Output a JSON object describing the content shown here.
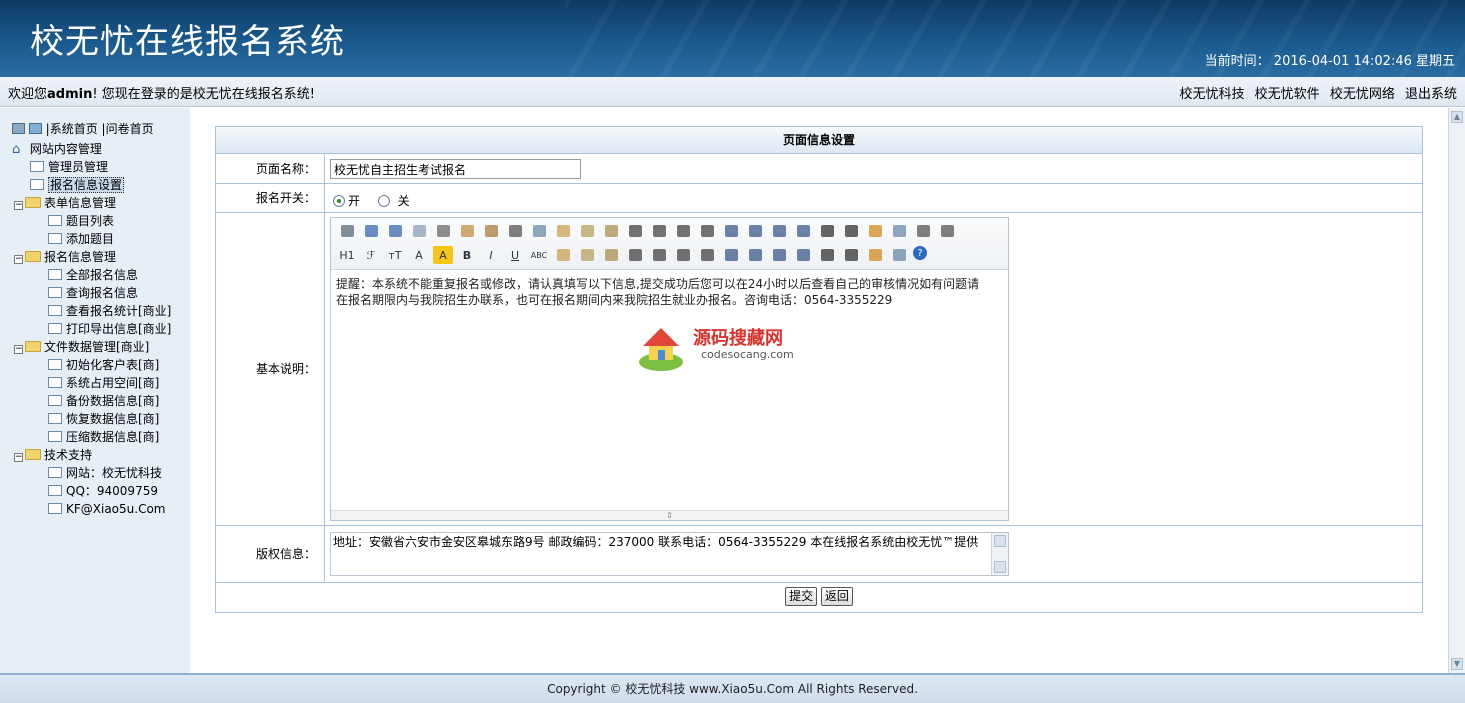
{
  "header": {
    "title": "校无忧在线报名系统",
    "clock_label": "当前时间：",
    "clock_value": "2016-04-01 14:02:46 星期五"
  },
  "welcome": {
    "prefix": "欢迎您",
    "user": "admin",
    "suffix": "! 您现在登录的是校无忧在线报名系统!",
    "links": [
      "校无忧科技",
      "校无忧软件",
      "校无忧网络",
      "退出系统"
    ]
  },
  "sidebar": {
    "top_links": [
      "系统首页",
      "问卷首页"
    ],
    "root": "网站内容管理",
    "items": [
      {
        "label": "管理员管理",
        "type": "page"
      },
      {
        "label": "报名信息设置",
        "type": "page",
        "selected": true
      },
      {
        "label": "表单信息管理",
        "type": "folder"
      },
      {
        "label": "题目列表",
        "type": "page"
      },
      {
        "label": "添加题目",
        "type": "page"
      },
      {
        "label": "报名信息管理",
        "type": "folder"
      },
      {
        "label": "全部报名信息",
        "type": "page"
      },
      {
        "label": "查询报名信息",
        "type": "page"
      },
      {
        "label": "查看报名统计[商业]",
        "type": "page"
      },
      {
        "label": "打印导出信息[商业]",
        "type": "page"
      },
      {
        "label": "文件数据管理[商业]",
        "type": "folder"
      },
      {
        "label": "初始化客户表[商]",
        "type": "page"
      },
      {
        "label": "系统占用空间[商]",
        "type": "page"
      },
      {
        "label": "备份数据信息[商]",
        "type": "page"
      },
      {
        "label": "恢复数据信息[商]",
        "type": "page"
      },
      {
        "label": "压缩数据信息[商]",
        "type": "page"
      },
      {
        "label": "技术支持",
        "type": "folder"
      },
      {
        "label": "网站：校无忧科技",
        "type": "page"
      },
      {
        "label": "QQ：94009759",
        "type": "page"
      },
      {
        "label": "KF@Xiao5u.Com",
        "type": "page"
      }
    ]
  },
  "form": {
    "caption": "页面信息设置",
    "page_name_label": "页面名称：",
    "page_name_value": "校无忧自主招生考试报名",
    "switch_label": "报名开关：",
    "switch_on": "开",
    "switch_off": "关",
    "desc_label": "基本说明：",
    "desc_text_1": "提醒：本系统不能重复报名或修改，请认真填写以下信息,提交成功后您可以在24小时以后查看自己的审核情况如有问题请",
    "desc_text_2": "在报名期限内与我院招生办联系，也可在报名期间内来我院招生就业办报名。咨询电话：0564-3355229",
    "watermark_cn": "源码搜藏网",
    "watermark_en": "codesocang.com",
    "copyright_label": "版权信息：",
    "copyright_text": "地址：安徽省六安市金安区皋城东路9号  邮政编码：237000    联系电话：0564-3355229 本在线报名系统由校无忧™提供",
    "submit": "提交",
    "back": "返回"
  },
  "footer": {
    "text": "Copyright © 校无忧科技  www.Xiao5u.Com All Rights Reserved."
  },
  "colors": {
    "header_top": "#0e3a64",
    "header_bottom": "#2a6da3",
    "sidebar_bg": "#e6eef6",
    "panel_border": "#a9c2db"
  }
}
